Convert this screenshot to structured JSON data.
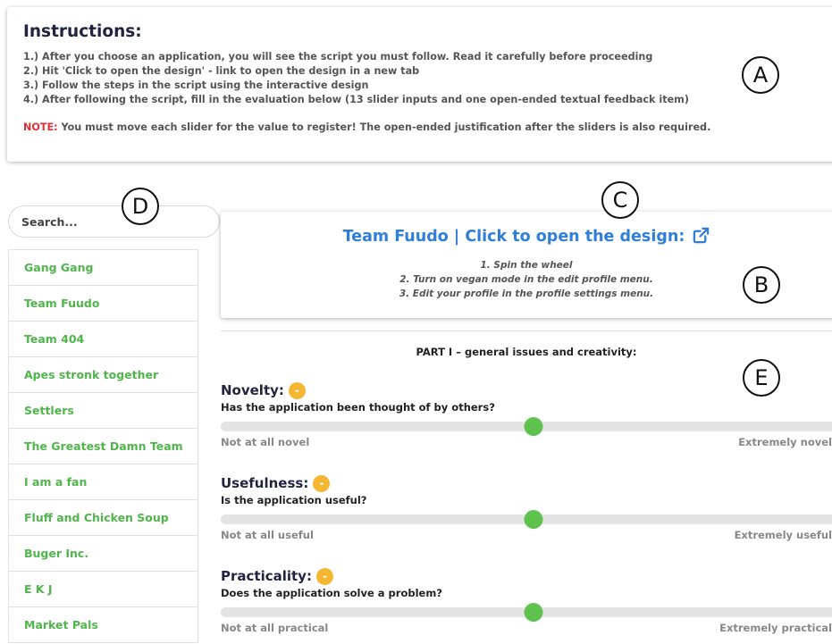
{
  "instructions": {
    "title": "Instructions:",
    "steps": [
      "1.) After you choose an application, you will see the script you must follow. Read it carefully before proceeding",
      "2.) Hit 'Click to open the design' - link to open the design in a new tab",
      "3.) Follow the steps in the script using the interactive design",
      "4.) After following the script, fill in the evaluation below (13 slider inputs and one open-ended textual feedback item)"
    ],
    "note_label": "NOTE:",
    "note_text": " You must move each slider for the value to register! The open-ended justification after the sliders is also required."
  },
  "markers": {
    "a": "A",
    "b": "B",
    "c": "C",
    "d": "D",
    "e": "E"
  },
  "search": {
    "placeholder": "Search..."
  },
  "teams": [
    "Gang Gang",
    "Team Fuudo",
    "Team 404",
    "Apes stronk together",
    "Settlers",
    "The Greatest Damn Team",
    "I am a fan",
    "Fluff and Chicken Soup",
    "Buger Inc.",
    "E K J",
    "Market Pals"
  ],
  "design": {
    "link_text": "Team Fuudo | Click to open the design:",
    "icon": "external-link-icon",
    "steps": [
      "1. Spin the wheel",
      "2. Turn on vegan mode in the edit profile menu.",
      "3. Edit your profile in the profile settings menu."
    ]
  },
  "part_title": "PART I – general issues and creativity:",
  "criteria": [
    {
      "title": "Novelty:",
      "badge": "-",
      "question": "Has the application been thought of by others?",
      "low": "Not at all novel",
      "high": "Extremely novel",
      "value": 0.5
    },
    {
      "title": "Usefulness:",
      "badge": "-",
      "question": "Is the application useful?",
      "low": "Not at all useful",
      "high": "Extremely useful",
      "value": 0.5
    },
    {
      "title": "Practicality:",
      "badge": "-",
      "question": "Does the application solve a problem?",
      "low": "Not at all practical",
      "high": "Extremely practical",
      "value": 0.5
    }
  ],
  "colors": {
    "accent_green": "#5fc24f",
    "team_text_green": "#4fb64a",
    "link_blue": "#2f7fd8",
    "badge_orange": "#f5b731",
    "note_red": "#e0303a"
  }
}
